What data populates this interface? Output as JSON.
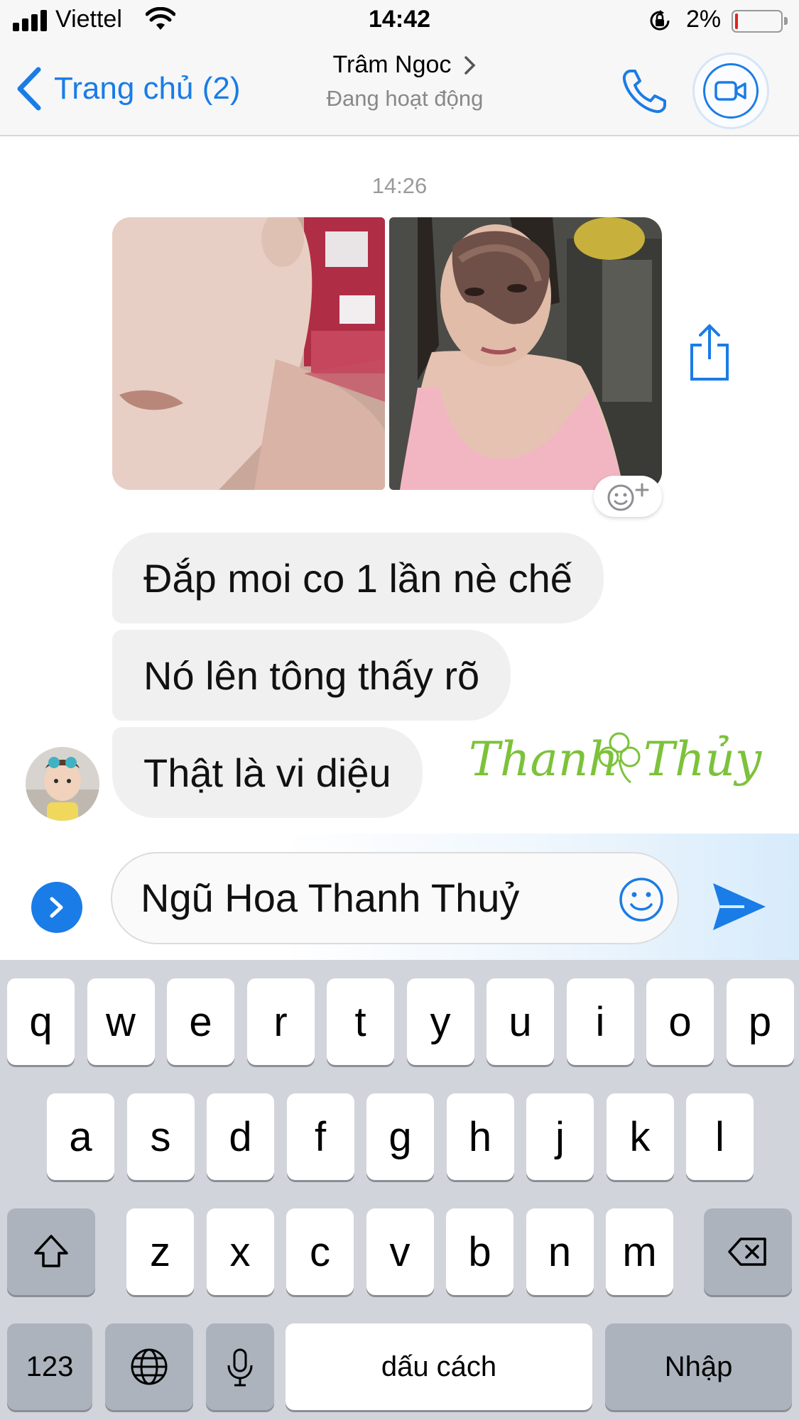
{
  "status_bar": {
    "carrier": "Viettel",
    "time": "14:42",
    "battery_percent": "2%",
    "battery_level": 0.02,
    "icons": [
      "signal-icon",
      "wifi-icon",
      "orientation-lock-icon",
      "battery-icon"
    ]
  },
  "header": {
    "back_label": "Trang chủ (2)",
    "contact_name": "Trâm Ngoc",
    "contact_status": "Đang hoạt động",
    "icons": [
      "back-chevron-icon",
      "chevron-right-icon",
      "phone-icon",
      "video-camera-icon"
    ]
  },
  "chat": {
    "timestamp": "14:26",
    "photos": [
      "photo-neck-closeup",
      "photo-face-mask-selfie"
    ],
    "messages": [
      {
        "text": "Đắp moi co 1 lần nè chế"
      },
      {
        "text": "Nó lên tông thấy rõ"
      },
      {
        "text": "Thật là vi diệu"
      }
    ],
    "watermark": "Thanh Thủy",
    "icons": [
      "share-icon",
      "add-reaction-icon",
      "avatar"
    ]
  },
  "composer": {
    "input_value": "Ngũ Hoa Thanh Thuỷ",
    "icons": [
      "expand-icon",
      "emoji-icon",
      "send-icon"
    ]
  },
  "keyboard": {
    "row1": [
      "q",
      "w",
      "e",
      "r",
      "t",
      "y",
      "u",
      "i",
      "o",
      "p"
    ],
    "row2": [
      "a",
      "s",
      "d",
      "f",
      "g",
      "h",
      "j",
      "k",
      "l"
    ],
    "row3": [
      "z",
      "x",
      "c",
      "v",
      "b",
      "n",
      "m"
    ],
    "numbers_label": "123",
    "space_label": "dấu cách",
    "return_label": "Nhập",
    "icons": [
      "shift-icon",
      "backspace-icon",
      "globe-icon",
      "microphone-icon"
    ]
  },
  "colors": {
    "accent": "#1a7ce6",
    "bubble": "#f0f0f0",
    "watermark": "#7cc23a",
    "keyboard_bg": "#d1d4da",
    "battery_low": "#e0241b"
  }
}
